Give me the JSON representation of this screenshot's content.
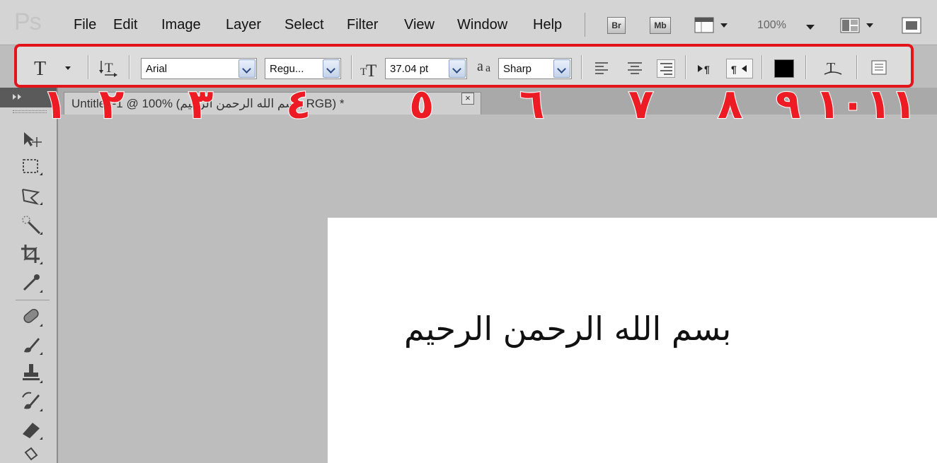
{
  "app": {
    "logo": "Ps"
  },
  "menu": [
    "File",
    "Edit",
    "Image",
    "Layer",
    "Select",
    "Filter",
    "View",
    "Window",
    "Help"
  ],
  "menubar_right": {
    "bridge_label": "Br",
    "minibridge_label": "Mb",
    "zoom": "100%"
  },
  "options_bar": {
    "font_family": "Arial",
    "font_style": "Regu...",
    "font_size": "37.04 pt",
    "aa_label": "a",
    "aa_label2": "a",
    "anti_alias": "Sharp",
    "text_color": "#000000"
  },
  "callouts": [
    "١",
    "٢",
    "٣",
    "٤",
    "٥",
    "٦",
    "٧",
    "٨",
    "٩",
    "١٠",
    "١١"
  ],
  "document": {
    "tab_title": "Untitled-1 @ 100% (بسم الله الرحمن الرحيم, RGB) *",
    "tab_close": "×",
    "text": "بسم الله الرحمن الرحيم"
  },
  "icons": {
    "text_tool": "text-tool-icon",
    "orientation": "text-orientation-icon",
    "size": "font-size-icon",
    "warp": "warped-text-icon",
    "panels": "character-panel-icon"
  }
}
